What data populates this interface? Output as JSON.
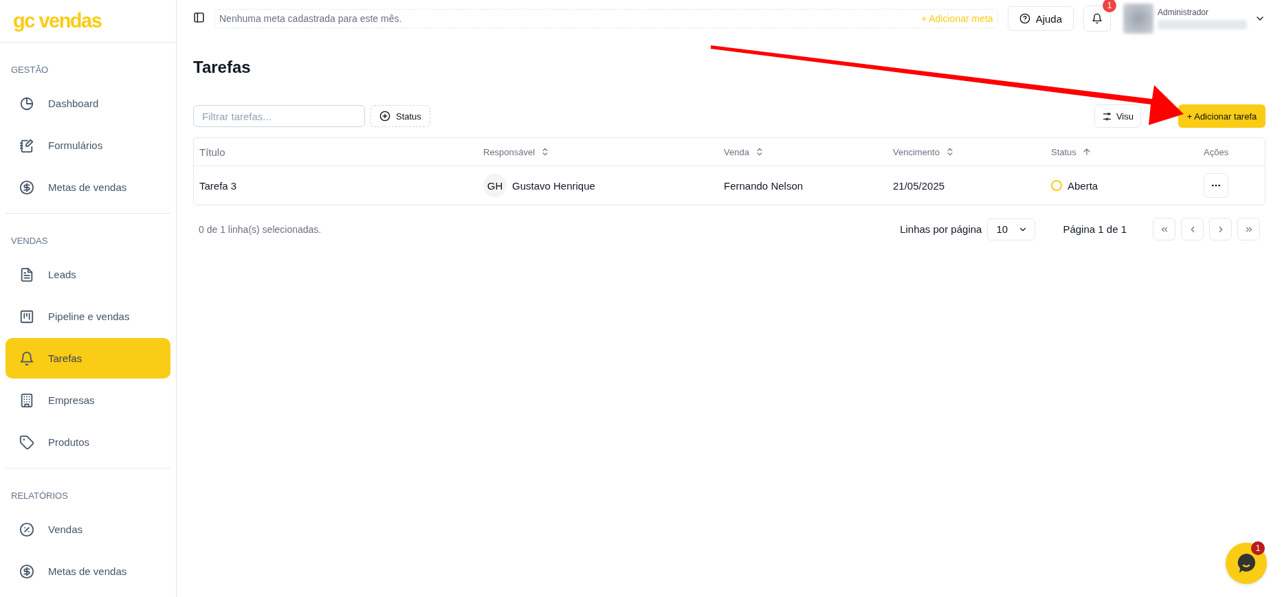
{
  "logo": "gc vendas",
  "sidebar": {
    "sections": [
      {
        "label": "GESTÃO",
        "items": [
          {
            "label": "Dashboard",
            "selected": false
          },
          {
            "label": "Formulários",
            "selected": false
          },
          {
            "label": "Metas de vendas",
            "selected": false
          }
        ]
      },
      {
        "label": "VENDAS",
        "items": [
          {
            "label": "Leads",
            "selected": false
          },
          {
            "label": "Pipeline e vendas",
            "selected": false
          },
          {
            "label": "Tarefas",
            "selected": true
          },
          {
            "label": "Empresas",
            "selected": false
          },
          {
            "label": "Produtos",
            "selected": false
          }
        ]
      },
      {
        "label": "RELATÓRIOS",
        "items": [
          {
            "label": "Vendas",
            "selected": false
          },
          {
            "label": "Metas de vendas",
            "selected": false
          }
        ]
      }
    ]
  },
  "topbar": {
    "goal_text": "Nenhuma meta cadastrada para este mês.",
    "add_goal": "+ Adicionar meta",
    "help": "Ajuda",
    "notifications": "1",
    "user_role": "Administrador"
  },
  "page": {
    "title": "Tarefas",
    "filter": {
      "placeholder": "Filtrar tarefas..."
    },
    "status_filter": "Status",
    "view_button": "Visu",
    "add_button": "+ Adicionar tarefa"
  },
  "table": {
    "columns": [
      {
        "label": "Título",
        "kind": "plain"
      },
      {
        "label": "Responsável",
        "kind": "sortable"
      },
      {
        "label": "Venda",
        "kind": "sortable"
      },
      {
        "label": "Vencimento",
        "kind": "sortable"
      },
      {
        "label": "Status",
        "kind": "sorted"
      },
      {
        "label": "Ações",
        "kind": "plain"
      }
    ],
    "rows": [
      {
        "title": "Tarefa 3",
        "initials": "GH",
        "responsible": "Gustavo Henrique",
        "sale": "Fernando Nelson",
        "due": "21/05/2025",
        "status": "Aberta"
      }
    ]
  },
  "footer": {
    "selection": "0 de 1 linha(s) selecionadas.",
    "rows_label": "Linhas por página",
    "rows_value": "10",
    "page": "Página 1 de 1"
  },
  "chat": {
    "badge": "1"
  }
}
